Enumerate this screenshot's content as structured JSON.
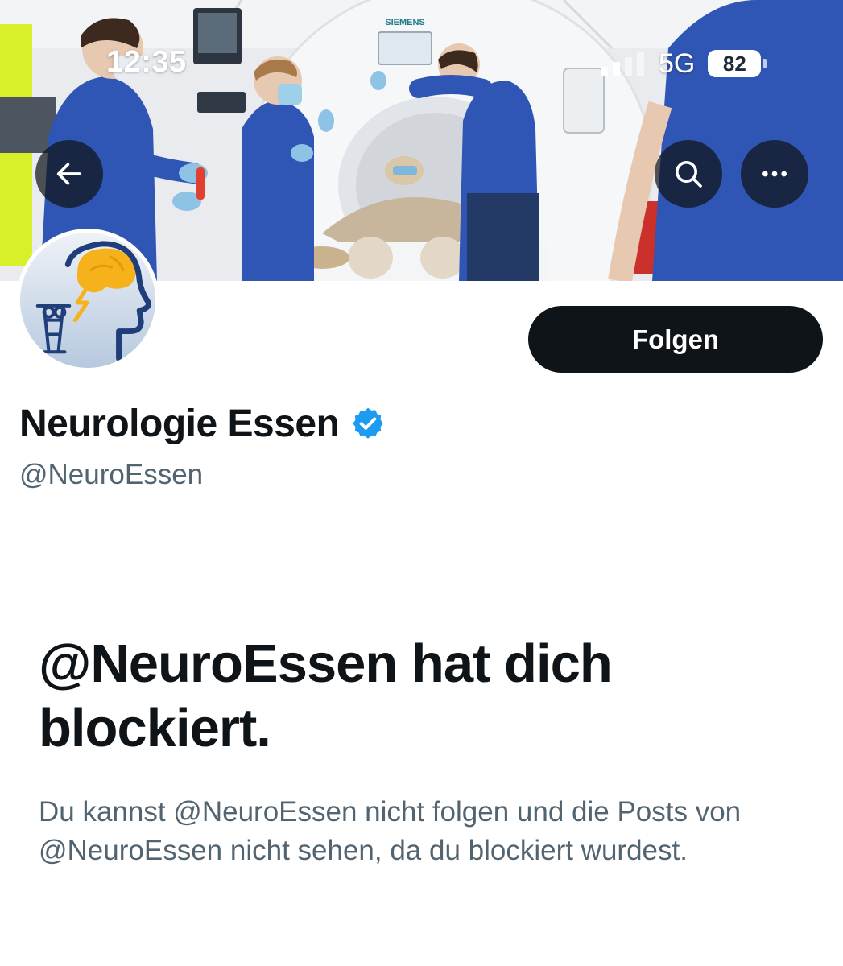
{
  "status_bar": {
    "time": "12:35",
    "network": "5G",
    "battery": "82",
    "signal_bars_active": 2,
    "signal_bars_total": 4
  },
  "nav": {
    "back_icon": "arrow-left-icon",
    "search_icon": "search-icon",
    "more_icon": "more-horizontal-icon"
  },
  "banner": {
    "description_icon": "banner-photo",
    "brand_text": "SIEMENS"
  },
  "profile": {
    "display_name": "Neurologie Essen",
    "handle": "@NeuroEssen",
    "verified_icon": "verified-badge-icon",
    "follow_label": "Folgen"
  },
  "blocked": {
    "title": "@NeuroEssen hat dich blockiert.",
    "body": "Du kannst @NeuroEssen nicht folgen und die Posts von @NeuroEssen nicht sehen, da du blockiert wurdest."
  },
  "colors": {
    "primary_text": "#0f1419",
    "secondary_text": "#536471",
    "verified_blue": "#1d9bf0",
    "button_dark": "#0f1419"
  }
}
